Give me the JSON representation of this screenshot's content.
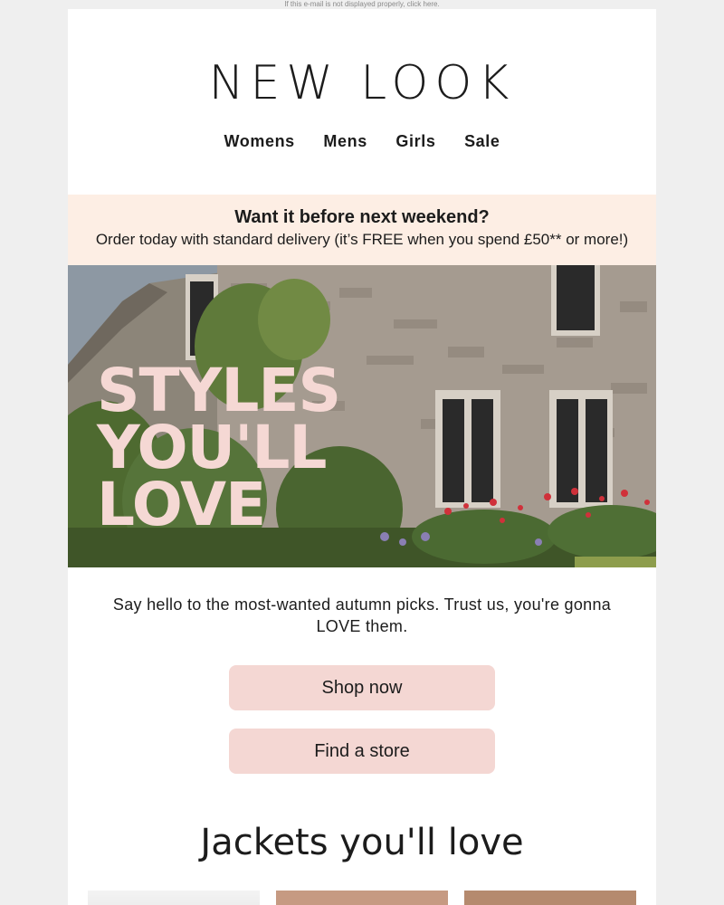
{
  "preheader": "If this e-mail is not displayed properly, click here.",
  "brand": {
    "logo_text": "NEW LOOK"
  },
  "nav": {
    "items": [
      "Womens",
      "Mens",
      "Girls",
      "Sale"
    ]
  },
  "delivery_banner": {
    "title": "Want it before next weekend?",
    "subtitle": "Order today with standard delivery (it’s FREE when you spend £50** or more!)"
  },
  "hero": {
    "headline_lines": [
      "STYLES",
      "YOU'LL",
      "LOVE"
    ]
  },
  "intro_text": "Say hello to the most-wanted autumn picks. Trust us, you're gonna LOVE them.",
  "buttons": {
    "shop_now": "Shop now",
    "find_store": "Find a store"
  },
  "section": {
    "title": "Jackets you'll love"
  },
  "colors": {
    "page_bg": "#efefef",
    "banner_bg": "#fdeee4",
    "button_bg": "#f4d7d3",
    "hero_text": "#f5d8d4",
    "text": "#1c1c1c"
  }
}
